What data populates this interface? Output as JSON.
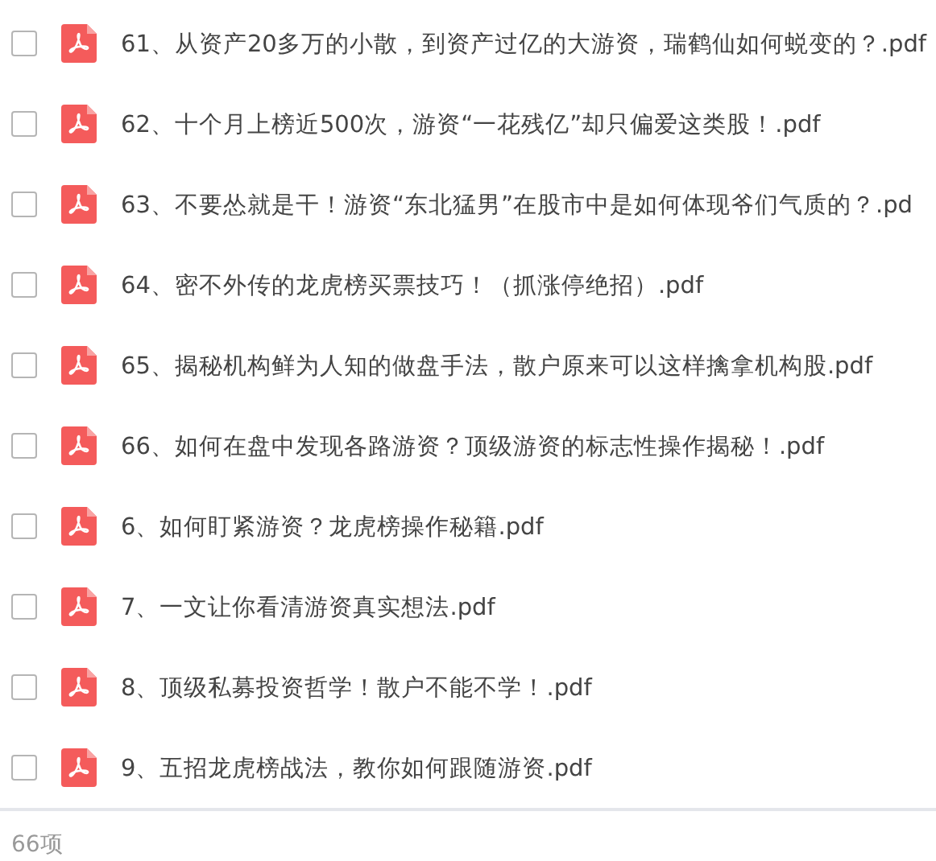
{
  "files": [
    {
      "name": "61、从资产20多万的小散，到资产过亿的大游资，瑞鹤仙如何蜕变的？.pdf",
      "checked": false
    },
    {
      "name": "62、十个月上榜近500次，游资“一花残亿”却只偏爱这类股！.pdf",
      "checked": false
    },
    {
      "name": "63、不要怂就是干！游资“东北猛男”在股市中是如何体现爷们气质的？.pd",
      "checked": false
    },
    {
      "name": "64、密不外传的龙虎榜买票技巧！（抓涨停绝招）.pdf",
      "checked": false
    },
    {
      "name": "65、揭秘机构鲜为人知的做盘手法，散户原来可以这样擒拿机构股.pdf",
      "checked": false
    },
    {
      "name": "66、如何在盘中发现各路游资？顶级游资的标志性操作揭秘！.pdf",
      "checked": false
    },
    {
      "name": "6、如何盯紧游资？龙虎榜操作秘籍.pdf",
      "checked": false
    },
    {
      "name": "7、一文让你看清游资真实想法.pdf",
      "checked": false
    },
    {
      "name": "8、顶级私募投资哲学！散户不能不学！.pdf",
      "checked": false
    },
    {
      "name": "9、五招龙虎榜战法，教你如何跟随游资.pdf",
      "checked": false
    }
  ],
  "footer": {
    "count": "66项"
  }
}
